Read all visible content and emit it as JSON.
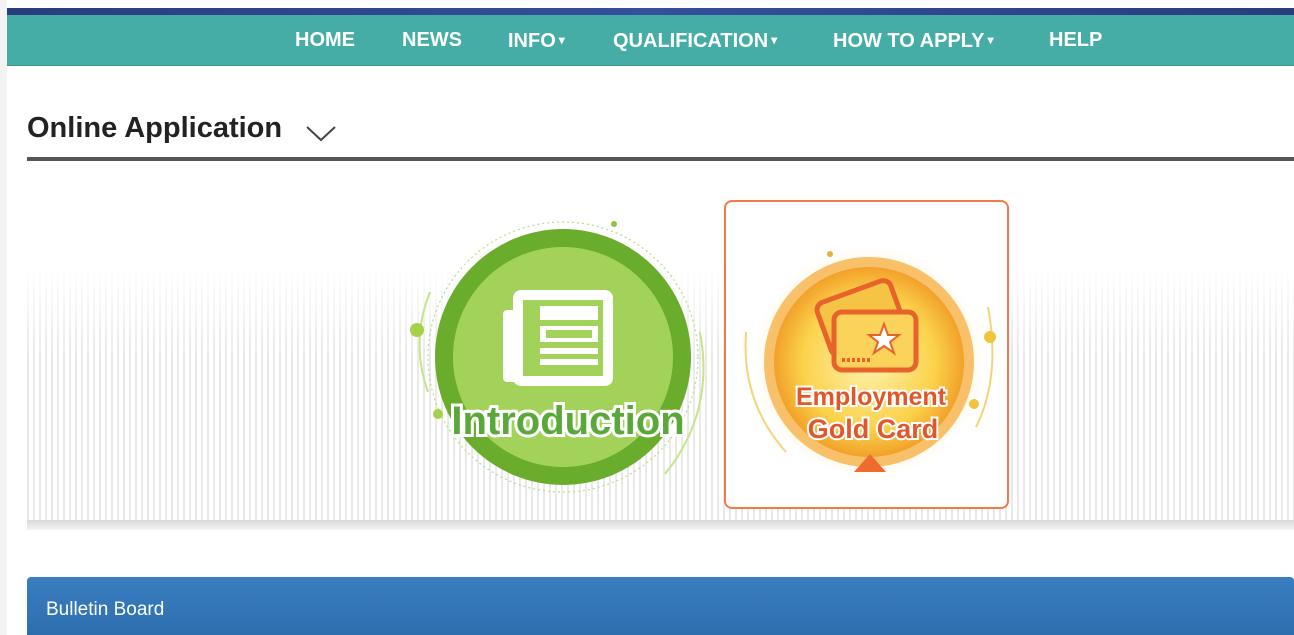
{
  "nav": {
    "items": [
      {
        "label": "HOME",
        "has_dropdown": false
      },
      {
        "label": "NEWS",
        "has_dropdown": false
      },
      {
        "label": "INFO",
        "has_dropdown": true
      },
      {
        "label": "QUALIFICATION",
        "has_dropdown": true
      },
      {
        "label": "HOW TO APPLY",
        "has_dropdown": true
      },
      {
        "label": "HELP",
        "has_dropdown": false
      }
    ],
    "dropdown_caret": "▾"
  },
  "section": {
    "title": "Online Application",
    "chevron_icon": "chevron-down-icon"
  },
  "cards": {
    "introduction": {
      "label": "Introduction",
      "icon": "newspaper-icon",
      "color": "#6db33f"
    },
    "gold_card": {
      "line1": "Employment",
      "line2": "Gold Card",
      "icon": "cards-icon",
      "color": "#f39a2b",
      "selected": true
    }
  },
  "bulletin": {
    "title": "Bulletin Board"
  },
  "colors": {
    "nav": "#45ada5",
    "accent": "#f27a4b",
    "bulletin": "#2f71b1"
  }
}
